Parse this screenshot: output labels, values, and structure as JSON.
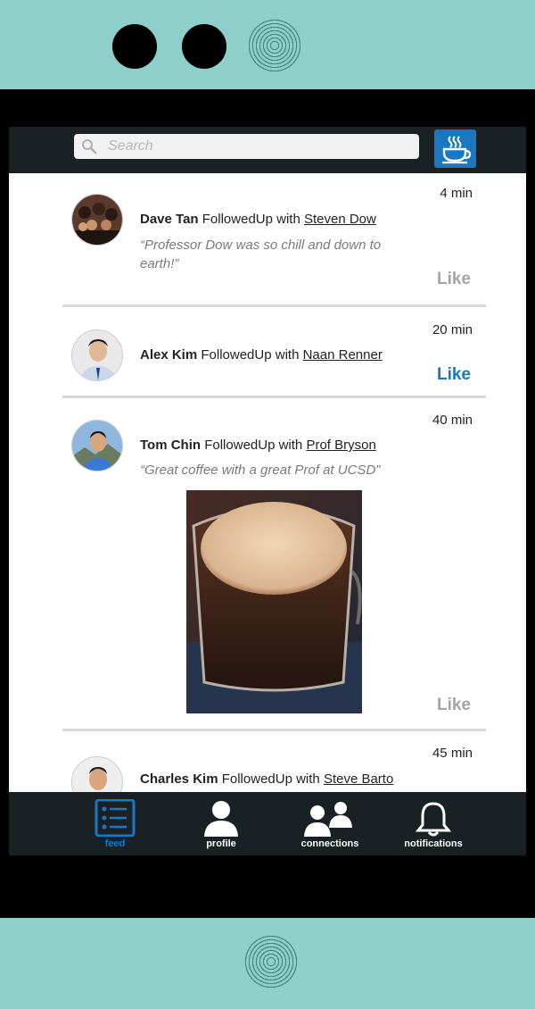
{
  "search": {
    "placeholder": "Search"
  },
  "header": {
    "action_icon": "coffee-cup-icon"
  },
  "feed": [
    {
      "author": "Dave Tan",
      "action": "FollowedUp with",
      "target": "Steven Dow",
      "time": "4 min",
      "quote": "“Professor Dow was so chill and down to earth!”",
      "like": "Like",
      "liked": false
    },
    {
      "author": "Alex Kim",
      "action": "FollowedUp with",
      "target": "Naan Renner",
      "time": "20 min",
      "quote": "",
      "like": "Like",
      "liked": true
    },
    {
      "author": "Tom Chin",
      "action": "FollowedUp with",
      "target": "Prof Bryson",
      "time": "40 min",
      "quote": "“Great coffee with a great Prof at UCSD”",
      "like": "Like",
      "liked": false
    },
    {
      "author": "Charles Kim",
      "action": "FollowedUp with",
      "target": "Steve Barto",
      "time": "45 min",
      "quote": "",
      "like": "",
      "liked": false
    }
  ],
  "nav": {
    "feed": "feed",
    "profile": "profile",
    "connections": "connections",
    "notifications": "notifications"
  },
  "colors": {
    "accent": "#1a78c2",
    "bar": "#1a2124",
    "phone": "#8fcfca"
  }
}
